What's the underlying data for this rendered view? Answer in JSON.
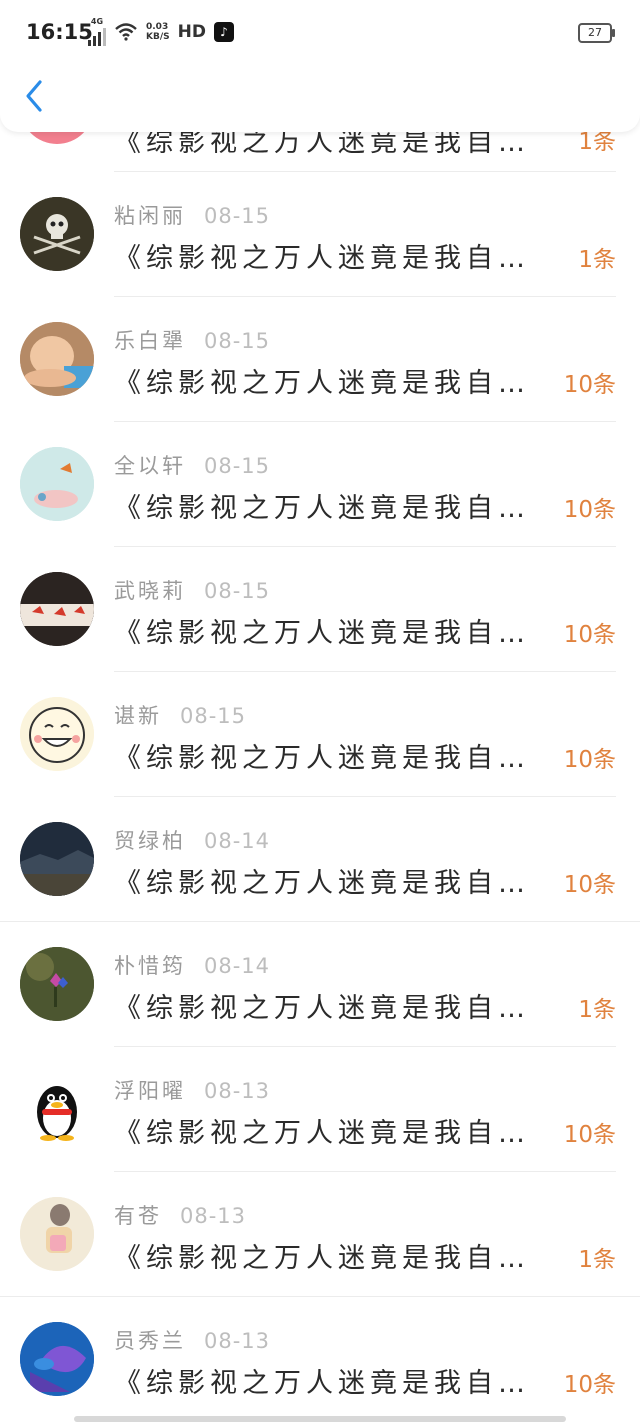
{
  "status_bar": {
    "time": "16:15",
    "network": "4G",
    "net_speed_value": "0.03",
    "net_speed_unit": "KB/S",
    "hd": "HD",
    "battery": "27"
  },
  "header": {
    "back_icon": "chevron-left-icon"
  },
  "partial_row": {
    "title": "《综影视之万人迷竟是我自己》",
    "count": "1条"
  },
  "items": [
    {
      "name": "粘闲丽",
      "date": "08-15",
      "title": "《综影视之万人迷竟是我自己》",
      "count": "1条"
    },
    {
      "name": "乐白犟",
      "date": "08-15",
      "title": "《综影视之万人迷竟是我自…",
      "count": "10条"
    },
    {
      "name": "全以轩",
      "date": "08-15",
      "title": "《综影视之万人迷竟是我自…",
      "count": "10条"
    },
    {
      "name": "武晓莉",
      "date": "08-15",
      "title": "《综影视之万人迷竟是我自…",
      "count": "10条"
    },
    {
      "name": "谌新",
      "date": "08-15",
      "title": "《综影视之万人迷竟是我自…",
      "count": "10条"
    },
    {
      "name": "贸绿柏",
      "date": "08-14",
      "title": "《综影视之万人迷竟是我自…",
      "count": "10条"
    },
    {
      "name": "朴惜筠",
      "date": "08-14",
      "title": "《综影视之万人迷竟是我自己》",
      "count": "1条"
    },
    {
      "name": "浮阳曜",
      "date": "08-13",
      "title": "《综影视之万人迷竟是我自…",
      "count": "10条"
    },
    {
      "name": "有苍",
      "date": "08-13",
      "title": "《综影视之万人迷竟是我自己》",
      "count": "1条"
    },
    {
      "name": "员秀兰",
      "date": "08-13",
      "title": "《综影视之万人迷竟是我自…",
      "count": "10条"
    }
  ],
  "colors": {
    "accent": "#2a8ce8",
    "count": "#e0823e"
  }
}
